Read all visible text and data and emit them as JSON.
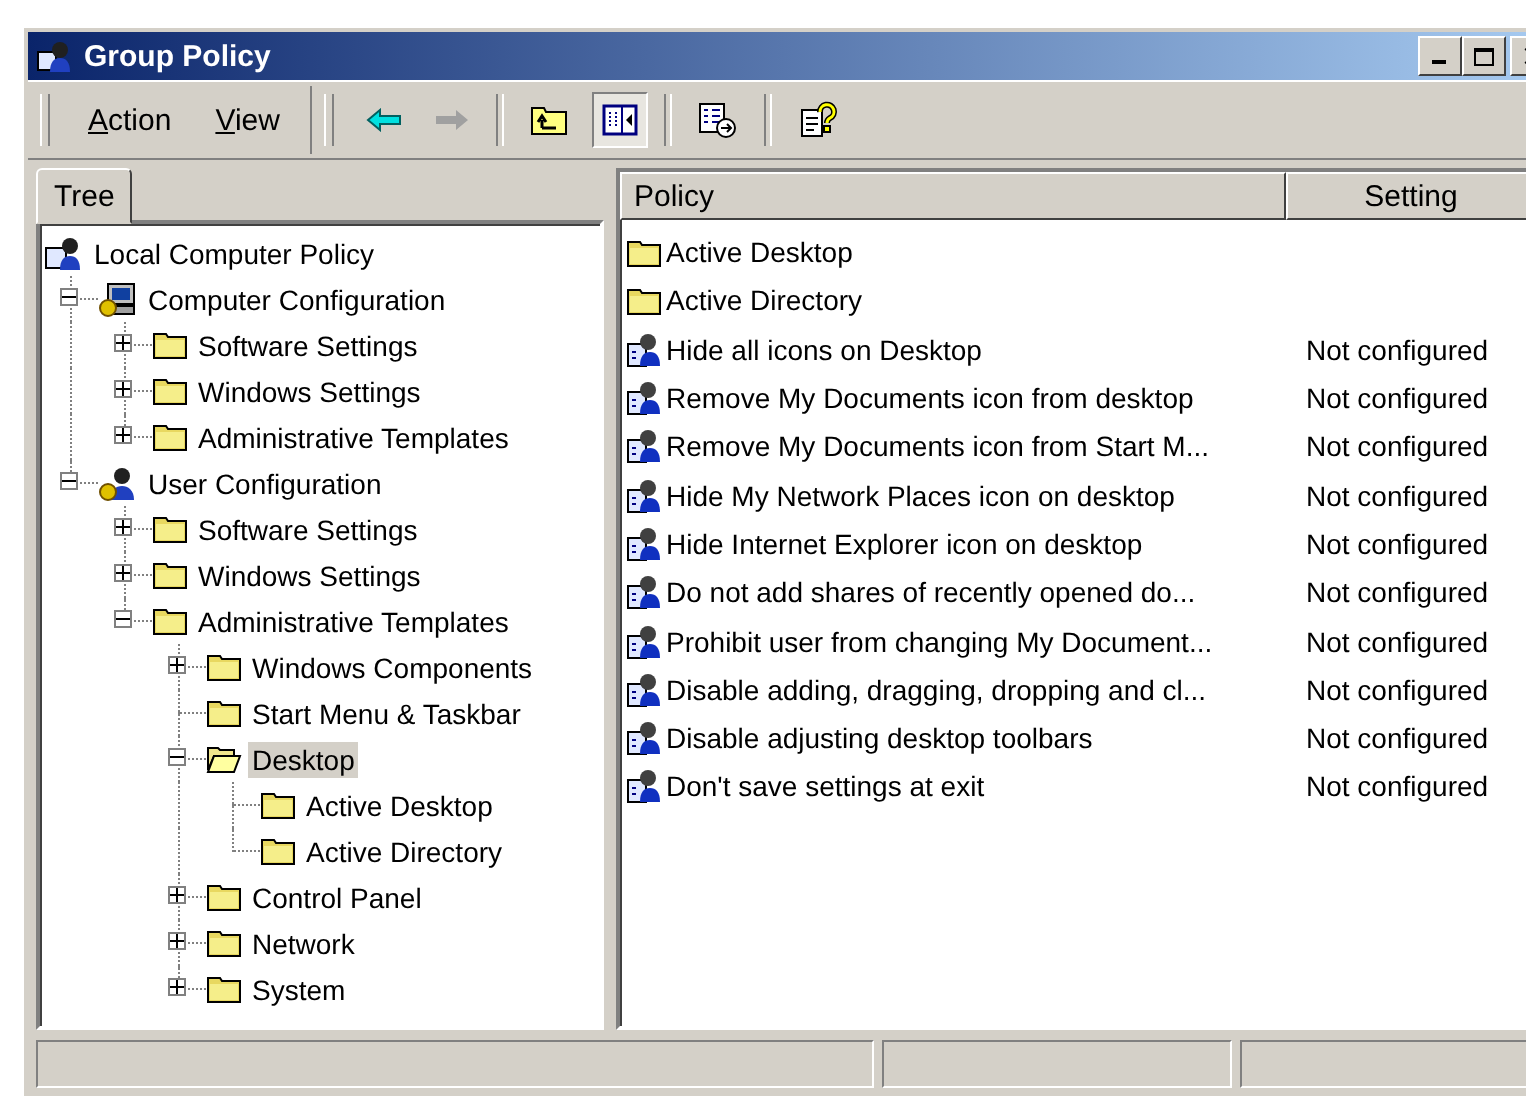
{
  "window": {
    "title": "Group Policy"
  },
  "menu": [
    {
      "label": "Action"
    },
    {
      "label": "View"
    }
  ],
  "toolbar": [
    {
      "kind": "back",
      "disabled": false,
      "selected": false
    },
    {
      "kind": "forward",
      "disabled": true,
      "selected": false
    },
    {
      "kind": "separator"
    },
    {
      "kind": "up",
      "selected": false
    },
    {
      "kind": "show-tree",
      "selected": true
    },
    {
      "kind": "separator"
    },
    {
      "kind": "export",
      "selected": false
    },
    {
      "kind": "separator"
    },
    {
      "kind": "help",
      "selected": false
    }
  ],
  "tabs": [
    {
      "label": "Tree",
      "selected": true
    }
  ],
  "tree": {
    "label": "Local Computer Policy",
    "kind": "policy",
    "selected": false,
    "children": [
      {
        "label": "Computer Configuration",
        "kind": "computer",
        "expanded": true,
        "selected": false,
        "children": [
          {
            "label": "Software Settings",
            "kind": "folder",
            "expanded": false,
            "selected": false
          },
          {
            "label": "Windows Settings",
            "kind": "folder",
            "expanded": false,
            "selected": false
          },
          {
            "label": "Administrative Templates",
            "kind": "folder",
            "expanded": false,
            "selected": false
          }
        ]
      },
      {
        "label": "User Configuration",
        "kind": "user",
        "expanded": true,
        "selected": false,
        "children": [
          {
            "label": "Software Settings",
            "kind": "folder",
            "expanded": false,
            "selected": false
          },
          {
            "label": "Windows Settings",
            "kind": "folder",
            "expanded": false,
            "selected": false
          },
          {
            "label": "Administrative Templates",
            "kind": "folder",
            "expanded": true,
            "selected": false,
            "children": [
              {
                "label": "Windows Components",
                "kind": "folder",
                "expanded": false,
                "selected": false
              },
              {
                "label": "Start Menu & Taskbar",
                "kind": "folder",
                "selected": false
              },
              {
                "label": "Desktop",
                "kind": "folder",
                "expanded": true,
                "selected": true,
                "children": [
                  {
                    "label": "Active Desktop",
                    "kind": "folder",
                    "selected": false
                  },
                  {
                    "label": "Active Directory",
                    "kind": "folder",
                    "selected": false
                  }
                ]
              },
              {
                "label": "Control Panel",
                "kind": "folder",
                "expanded": false,
                "selected": false
              },
              {
                "label": "Network",
                "kind": "folder",
                "expanded": false,
                "selected": false
              },
              {
                "label": "System",
                "kind": "folder",
                "expanded": false,
                "selected": false
              }
            ]
          }
        ]
      }
    ]
  },
  "list": {
    "columns": [
      "Policy",
      "Setting"
    ],
    "rows": [
      {
        "kind": "folder",
        "policy": "Active Desktop"
      },
      {
        "kind": "folder",
        "policy": "Active Directory"
      },
      {
        "kind": "setting",
        "policy": "Hide all icons on Desktop",
        "setting": "Not configured"
      },
      {
        "kind": "setting",
        "policy": "Remove My Documents icon from desktop",
        "setting": "Not configured"
      },
      {
        "kind": "setting",
        "policy": "Remove My Documents icon from Start M...",
        "setting": "Not configured"
      },
      {
        "kind": "setting",
        "policy": "Hide My Network Places icon on desktop",
        "setting": "Not configured"
      },
      {
        "kind": "setting",
        "policy": "Hide Internet Explorer icon on desktop",
        "setting": "Not configured"
      },
      {
        "kind": "setting",
        "policy": "Do not add shares of recently opened do...",
        "setting": "Not configured"
      },
      {
        "kind": "setting",
        "policy": "Prohibit user from changing My Document...",
        "setting": "Not configured"
      },
      {
        "kind": "setting",
        "policy": "Disable adding, dragging, dropping and cl...",
        "setting": "Not configured"
      },
      {
        "kind": "setting",
        "policy": "Disable adjusting desktop toolbars",
        "setting": "Not configured"
      },
      {
        "kind": "setting",
        "policy": "Don't save settings at exit",
        "setting": "Not configured"
      }
    ]
  }
}
